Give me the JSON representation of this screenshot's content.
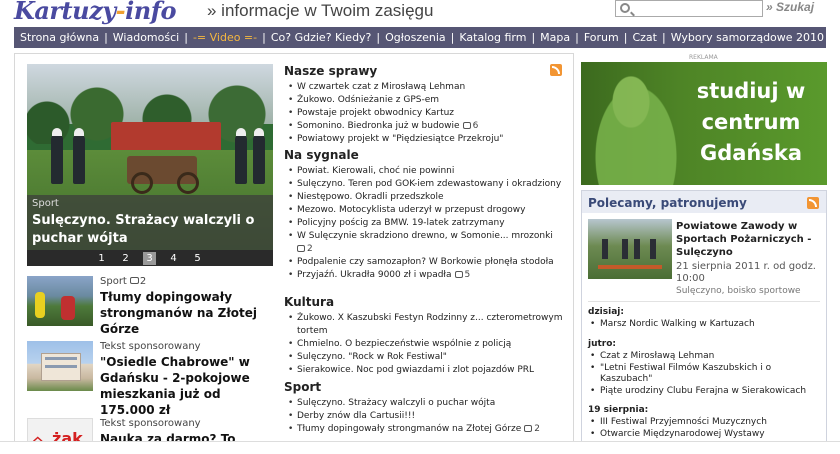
{
  "header": {
    "logo_main": "Kartuzy",
    "logo_dash": "-",
    "logo_end": "info",
    "tagline": "» informacje w Twoim zasięgu",
    "search_placeholder": "",
    "search_button": "» Szukaj"
  },
  "nav": {
    "items": [
      "Strona główna",
      "Wiadomości",
      "-= Video =-",
      "Co? Gdzie? Kiedy?",
      "Ogłoszenia",
      "Katalog firm",
      "Mapa",
      "Forum",
      "Czat",
      "Wybory samorządowe 2010"
    ],
    "separator": "|"
  },
  "hero": {
    "category": "Sport",
    "title": "Sulęczyno. Strażacy walczyli o puchar wójta",
    "pages": [
      "1",
      "2",
      "3",
      "4",
      "5"
    ],
    "active_page": "3"
  },
  "left_articles": [
    {
      "category": "Sport",
      "comments": "2",
      "title": "Tłumy dopingowały strongmanów na Złotej Górze"
    },
    {
      "category": "Tekst sponsorowany",
      "comments": "",
      "title": "\"Osiedle Chabrowe\" w Gdańsku - 2-pokojowe mieszkania już od 175.000 zł"
    },
    {
      "category": "Tekst sponsorowany",
      "comments": "",
      "title": "Nauka za darmo? To"
    }
  ],
  "sections": {
    "nasze_sprawy": {
      "title": "Nasze sprawy",
      "items": [
        {
          "text": "W czwartek czat z Mirosławą Lehman",
          "comments": ""
        },
        {
          "text": "Żukowo. Odśnieżanie z GPS-em",
          "comments": ""
        },
        {
          "text": "Powstaje projekt obwodnicy Kartuz",
          "comments": ""
        },
        {
          "text": "Somonino. Biedronka już w budowie",
          "comments": "6"
        },
        {
          "text": "Powiatowy projekt w \"Piędziesiątce Przekroju\"",
          "comments": ""
        }
      ]
    },
    "na_sygnale": {
      "title": "Na sygnale",
      "items": [
        {
          "text": "Powiat. Kierowali, choć nie powinni",
          "comments": ""
        },
        {
          "text": "Sulęczyno. Teren pod GOK-iem zdewastowany i okradziony",
          "comments": ""
        },
        {
          "text": "Niestępowo. Okradli przedszkole",
          "comments": ""
        },
        {
          "text": "Mezowo. Motocyklista uderzył w przepust drogowy",
          "comments": ""
        },
        {
          "text": "Policyjny pościg za BMW. 19-latek zatrzymany",
          "comments": ""
        },
        {
          "text": "W Sulęczynie skradziono drewno, w Somonie... mrozonki",
          "comments": "2"
        },
        {
          "text": "Podpalenie czy samozapłon? W Borkowie płonęła stodoła",
          "comments": ""
        },
        {
          "text": "Przyjaźń. Ukradła 9000 zł i wpadła",
          "comments": "5"
        }
      ]
    },
    "kultura": {
      "title": "Kultura",
      "items": [
        {
          "text": "Żukowo. X Kaszubski Festyn Rodzinny z... czterometrowym tortem",
          "comments": ""
        },
        {
          "text": "Chmielno. O bezpieczeństwie wspólnie z policją",
          "comments": ""
        },
        {
          "text": "Sulęczyno. \"Rock w Rok Festiwal\"",
          "comments": ""
        },
        {
          "text": "Sierakowice. Noc pod gwiazdami i zlot pojazdów PRL",
          "comments": ""
        }
      ]
    },
    "sport": {
      "title": "Sport",
      "items": [
        {
          "text": "Sulęczyno. Strażacy walczyli o puchar wójta",
          "comments": ""
        },
        {
          "text": "Derby znów dla Cartusii!!!",
          "comments": ""
        },
        {
          "text": "Tłumy dopingowały strongmanów na Złotej Górze",
          "comments": "2"
        }
      ]
    }
  },
  "ad": {
    "label": "REKLAMA",
    "text": "studiuj w centrum Gdańska"
  },
  "polecamy": {
    "title": "Polecamy, patronujemy",
    "event_title": "Powiatowe Zawody w Sportach Pożarniczych - Sulęczyno",
    "event_date": "21 sierpnia 2011 r. od godz. 10:00",
    "event_place": "Sulęczyno, boisko sportowe",
    "days": [
      {
        "label": "dzisiaj:",
        "items": [
          "Marsz Nordic Walking w Kartuzach"
        ]
      },
      {
        "label": "jutro:",
        "items": [
          "Czat z Mirosławą Lehman",
          "\"Letni Festiwal Filmów Kaszubskich i o Kaszubach\"",
          "Piąte urodziny Clubu Ferajna w Sierakowicach"
        ]
      },
      {
        "label": "19 sierpnia:",
        "items": [
          "III Festiwal Przyjemności Muzycznych",
          "Otwarcie Międzynarodowej Wystawy"
        ]
      }
    ]
  },
  "colors": {
    "nav_bg": "#565674",
    "video_accent": "#f5b840",
    "logo": "#4a4aa0",
    "polecamy_title": "#3a4a78",
    "ad_bg": "#4e8426",
    "rss": "#f29533"
  }
}
